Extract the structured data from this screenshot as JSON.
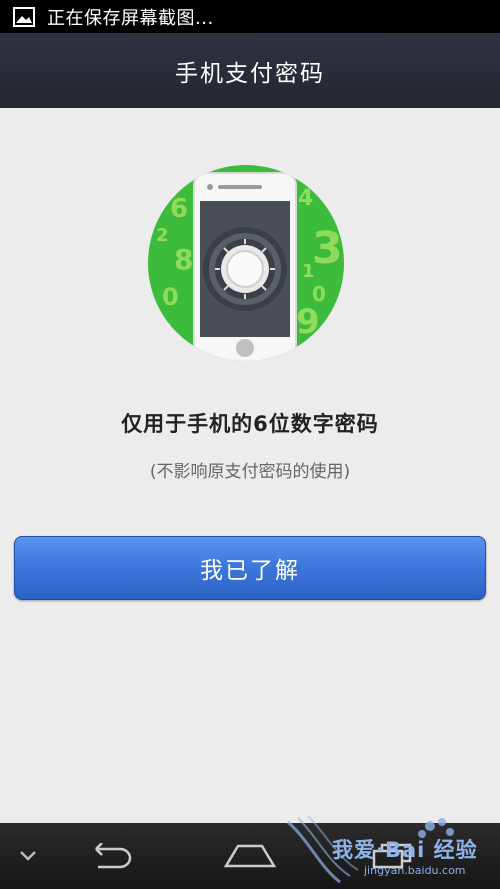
{
  "status_bar": {
    "icon": "image-icon",
    "text": "正在保存屏幕截图..."
  },
  "header": {
    "title": "手机支付密码"
  },
  "illustration": {
    "icon": "phone-safe-lock-icon",
    "accent_green": "#3dbb3d",
    "digits_left": [
      "6",
      "2",
      "8",
      "0"
    ],
    "digits_right": [
      "4",
      "3",
      "1",
      "0",
      "9"
    ]
  },
  "main": {
    "headline": "仅用于手机的6位数字密码",
    "subline": "(不影响原支付密码的使用)",
    "ack_button_label": "我已了解",
    "button_color": "#3f78dd"
  },
  "nav_bar": {
    "items": [
      "chevron-down-icon",
      "back-icon",
      "home-icon",
      "recent-apps-icon"
    ]
  },
  "watermark": {
    "text": "我爱·Bai 经验",
    "url": "jingyan.baidu.com"
  }
}
